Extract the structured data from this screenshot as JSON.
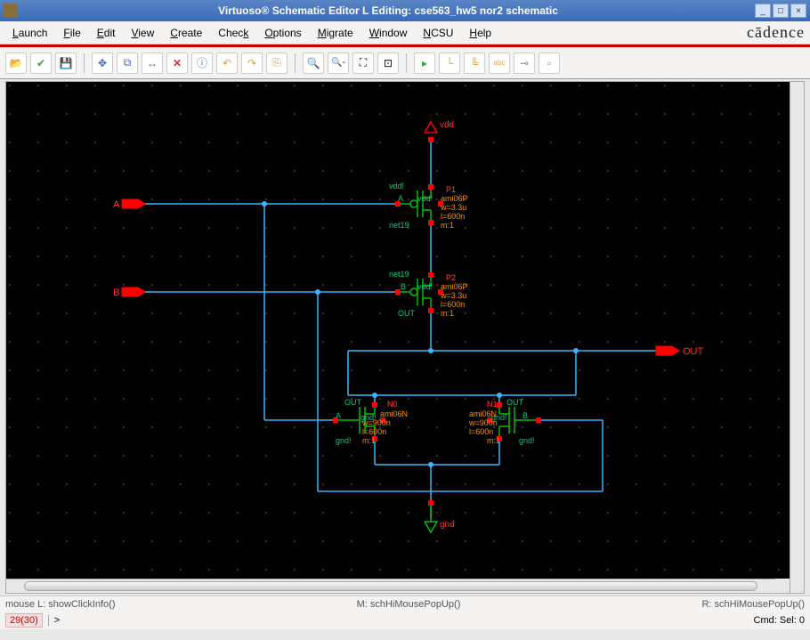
{
  "window": {
    "title": "Virtuoso® Schematic Editor L Editing: cse563_hw5 nor2 schematic"
  },
  "menu": {
    "launch": "Launch",
    "file": "File",
    "edit": "Edit",
    "view": "View",
    "create": "Create",
    "check": "Check",
    "options": "Options",
    "migrate": "Migrate",
    "window": "Window",
    "ncsu": "NCSU",
    "help": "Help"
  },
  "brand": "cādence",
  "toolbar_icons": [
    "open",
    "check",
    "save",
    "move",
    "copy",
    "stretch",
    "delete-x",
    "info",
    "undo",
    "redo",
    "create",
    "zoom-in",
    "zoom-out",
    "zoom-fit",
    "zoom-sel",
    "filter",
    "wire",
    "wide-wire",
    "label",
    "pin",
    "page"
  ],
  "pins": {
    "a": "A",
    "b": "B",
    "out": "OUT"
  },
  "supply": {
    "vdd": "vdd",
    "gnd": "gnd"
  },
  "transistors": {
    "P1": {
      "name": "P1",
      "model": "ami06P",
      "w": "w=3.3u",
      "l": "l=600n",
      "m": "m:1",
      "d": "vdd!",
      "g": "A",
      "s": "net19",
      "b": "vdd!"
    },
    "P2": {
      "name": "P2",
      "model": "ami06P",
      "w": "w=3.3u",
      "l": "l=600n",
      "m": "m:1",
      "d": "net19",
      "g": "B",
      "s": "OUT",
      "b": "vdd!"
    },
    "N0": {
      "name": "N0",
      "model": "ami06N",
      "w": "w=900n",
      "l": "l=600n",
      "m": "m:1",
      "d": "OUT",
      "g": "A",
      "s": "gnd!",
      "b": "gnd!"
    },
    "N1": {
      "name": "N1",
      "model": "ami06N",
      "w": "w=900n",
      "l": "l=600n",
      "m": "m:1",
      "d": "OUT",
      "g": "B",
      "s": "gnd!",
      "b": "gnd!"
    }
  },
  "status": {
    "mouse_l": "mouse L: showClickInfo()",
    "mouse_m": "M: schHiMousePopUp()",
    "mouse_r": "R: schHiMousePopUp()",
    "coord": "29(30)",
    "prompt": ">",
    "cmd": "Cmd: Sel: 0"
  }
}
